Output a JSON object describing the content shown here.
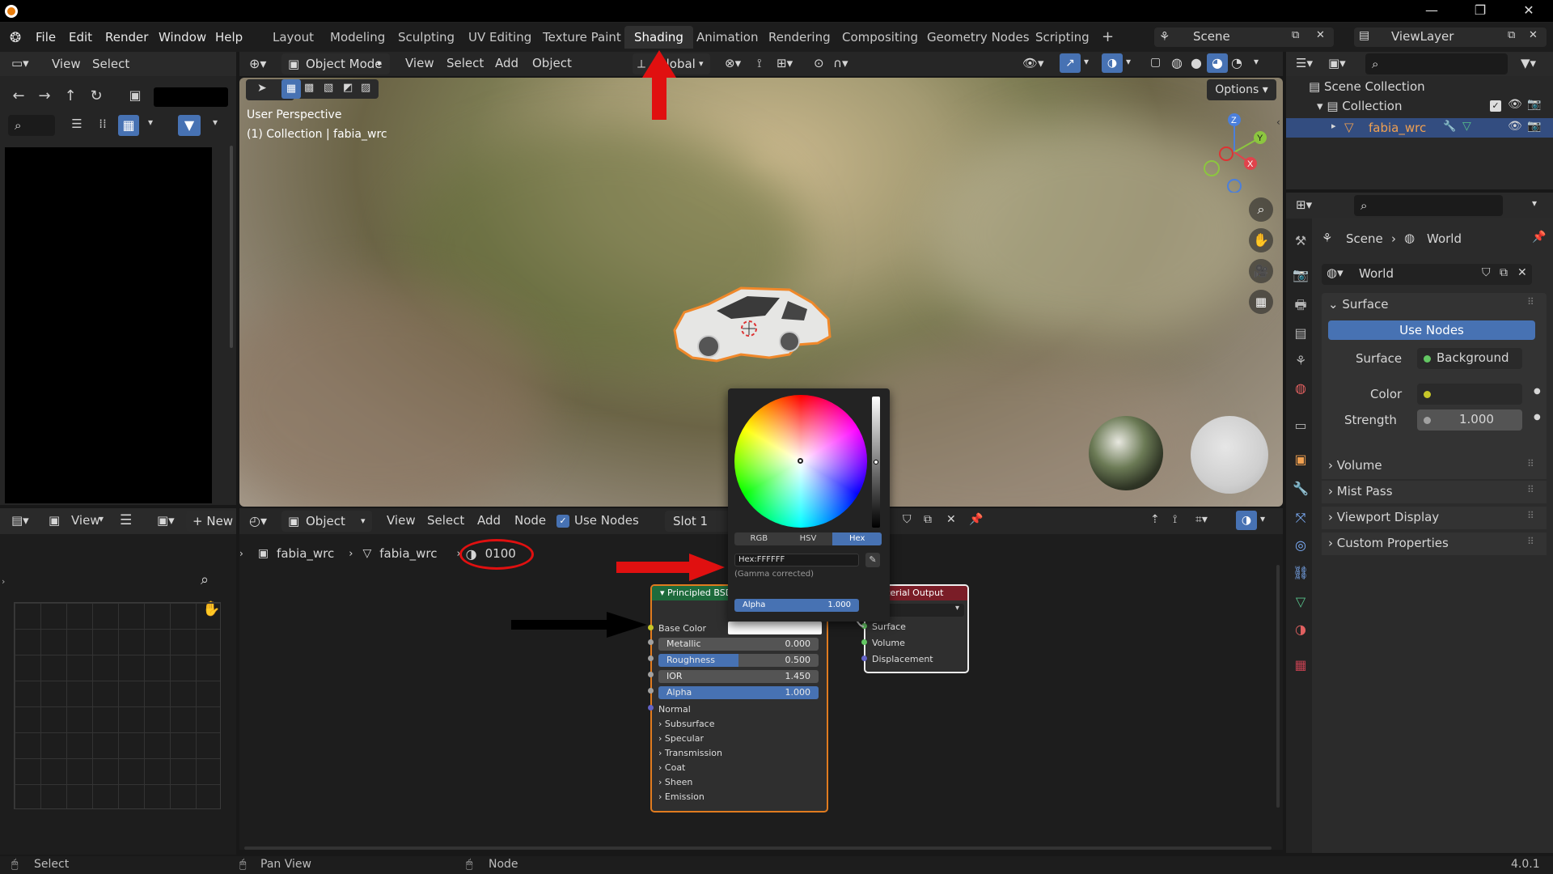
{
  "titlebar": {
    "minimize": "—",
    "restore": "❐",
    "close": "✕"
  },
  "menubar": {
    "items": [
      "File",
      "Edit",
      "Render",
      "Window",
      "Help"
    ],
    "workspaces": [
      "Layout",
      "Modeling",
      "Sculpting",
      "UV Editing",
      "Texture Paint",
      "Shading",
      "Animation",
      "Rendering",
      "Compositing",
      "Geometry Nodes",
      "Scripting"
    ],
    "active_workspace": "Shading",
    "add_tab": "+",
    "scene": "Scene",
    "view_layer": "ViewLayer"
  },
  "filebrowser": {
    "menu_view": "View",
    "menu_select": "Select"
  },
  "viewport": {
    "mode": "Object Mode",
    "menu": [
      "View",
      "Select",
      "Add",
      "Object"
    ],
    "transform_orientation": "Global",
    "options": "Options",
    "overlay_line1": "User Perspective",
    "overlay_line2": "(1) Collection | fabia_wrc",
    "gizmo_axes": [
      "Z",
      "Y",
      "X"
    ]
  },
  "image_editor": {
    "view": "View",
    "new": "New"
  },
  "node_editor": {
    "type": "Object",
    "menu": [
      "View",
      "Select",
      "Add",
      "Node"
    ],
    "use_nodes": "Use Nodes",
    "slot": "Slot 1",
    "breadcrumb": [
      "fabia_wrc",
      "fabia_wrc",
      "0100"
    ]
  },
  "principled": {
    "title": "Principled BSDF",
    "base_color": "Base Color",
    "metallic": {
      "label": "Metallic",
      "value": "0.000"
    },
    "roughness": {
      "label": "Roughness",
      "value": "0.500",
      "fraction": 0.5
    },
    "ior": {
      "label": "IOR",
      "value": "1.450"
    },
    "alpha": {
      "label": "Alpha",
      "value": "1.000",
      "fraction": 1.0
    },
    "normal": "Normal",
    "panels": [
      "Subsurface",
      "Specular",
      "Transmission",
      "Coat",
      "Sheen",
      "Emission"
    ]
  },
  "material_output": {
    "title": "Material Output",
    "inputs": [
      "Surface",
      "Volume",
      "Displacement"
    ]
  },
  "color_picker": {
    "tabs": [
      "RGB",
      "HSV",
      "Hex"
    ],
    "active_tab": "Hex",
    "hex_value": "Hex:FFFFFF",
    "note": "(Gamma corrected)",
    "alpha_label": "Alpha",
    "alpha_value": "1.000"
  },
  "outliner": {
    "scene_collection": "Scene Collection",
    "collection": "Collection",
    "object": "fabia_wrc"
  },
  "properties": {
    "breadcrumb": [
      "Scene",
      "World"
    ],
    "world_name": "World",
    "surface_panel": "Surface",
    "use_nodes": "Use Nodes",
    "surface_label": "Surface",
    "surface_value": "Background",
    "color_label": "Color",
    "strength_label": "Strength",
    "strength_value": "1.000",
    "panels": [
      "Volume",
      "Mist Pass",
      "Viewport Display",
      "Custom Properties"
    ]
  },
  "statusbar": {
    "select": "Select",
    "pan": "Pan View",
    "node": "Node",
    "version": "4.0.1"
  },
  "colors": {
    "accent": "#4772b3",
    "node_border": "#e07b1f",
    "annotation_red": "#e01010",
    "shader_header": "#1e6b3c",
    "output_header": "#7a1d27"
  }
}
